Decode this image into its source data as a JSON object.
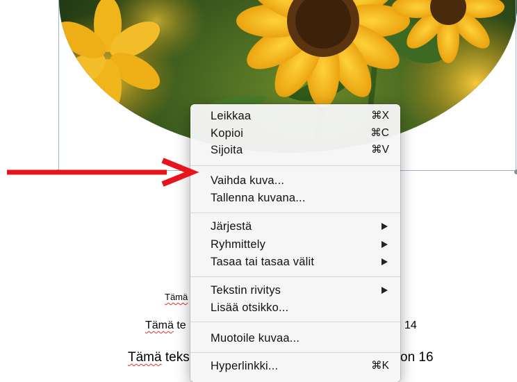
{
  "document": {
    "lines": [
      {
        "first_word": "Tämä",
        "rest": " te",
        "tail": "14"
      },
      {
        "first_word": "Tämä",
        "rest": " teks",
        "tail": "on 16"
      }
    ],
    "line_small": {
      "first_word": "Tämä"
    }
  },
  "context_menu": {
    "groups": [
      [
        {
          "label": "Leikkaa",
          "shortcut": "⌘X"
        },
        {
          "label": "Kopioi",
          "shortcut": "⌘C"
        },
        {
          "label": "Sijoita",
          "shortcut": "⌘V"
        }
      ],
      [
        {
          "label": "Vaihda kuva..."
        },
        {
          "label": "Tallenna kuvana..."
        }
      ],
      [
        {
          "label": "Järjestä",
          "submenu": true
        },
        {
          "label": "Ryhmittely",
          "submenu": true
        },
        {
          "label": "Tasaa tai tasaa välit",
          "submenu": true
        }
      ],
      [
        {
          "label": "Tekstin rivitys",
          "submenu": true
        },
        {
          "label": "Lisää otsikko..."
        }
      ],
      [
        {
          "label": "Muotoile kuvaa..."
        }
      ],
      [
        {
          "label": "Hyperlinkki...",
          "shortcut": "⌘K"
        }
      ]
    ]
  },
  "annotation": {
    "color": "#e8141c",
    "points_to": "Vaihda kuva..."
  },
  "icons": {
    "submenu": "chevron-right-icon",
    "arrow": "red-arrow-icon"
  }
}
